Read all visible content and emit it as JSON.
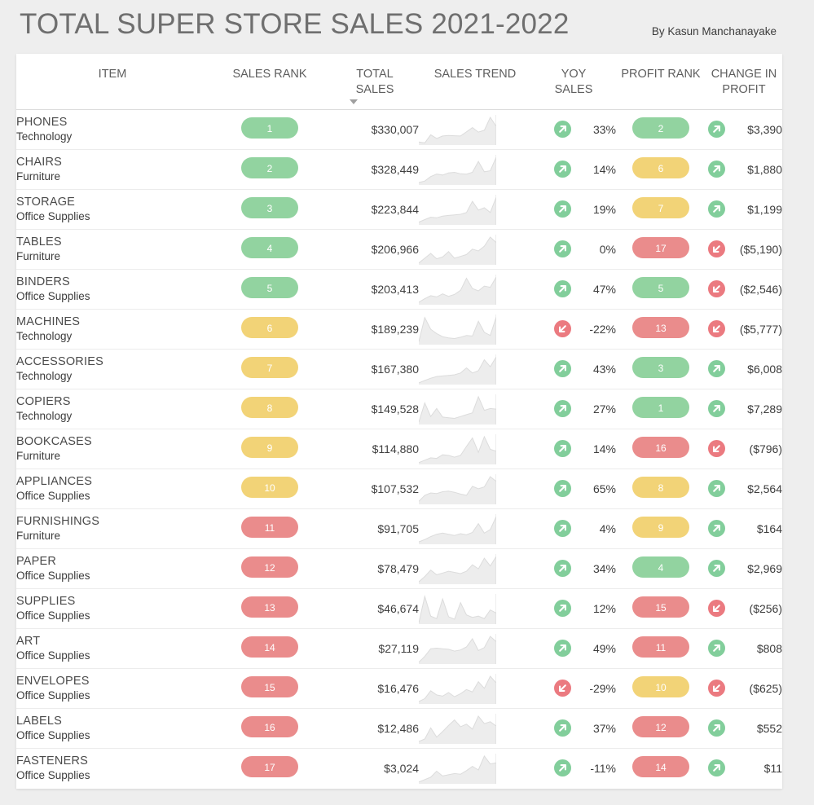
{
  "header": {
    "title": "TOTAL SUPER STORE SALES 2021-2022",
    "byline": "By Kasun Manchanayake"
  },
  "colors": {
    "page_background": "#EEEEEE",
    "card_background": "#FFFFFF",
    "green": "#92D3A0",
    "yellow": "#F2D377",
    "red": "#EA8C8C",
    "sparkline_fill": "#EDEDED",
    "sparkline_stroke": "#DCDCDC",
    "title_text": "#6F6F6F",
    "body_text": "#3C3C3C"
  },
  "table": {
    "columns": [
      {
        "key": "item",
        "label": "ITEM",
        "sorted": false
      },
      {
        "key": "rank",
        "label": "SALES RANK",
        "sorted": false
      },
      {
        "key": "total",
        "label": "TOTAL SALES",
        "sorted": true,
        "sort_direction": "desc"
      },
      {
        "key": "trend",
        "label": "SALES TREND",
        "sorted": false
      },
      {
        "key": "yoy",
        "label": "YOY SALES",
        "sorted": false
      },
      {
        "key": "prank",
        "label": "PROFIT RANK",
        "sorted": false
      },
      {
        "key": "change",
        "label": "CHANGE IN PROFIT",
        "sorted": false
      }
    ],
    "column_labels_wrapped": [
      [
        "ITEM",
        ""
      ],
      [
        "SALES RANK",
        ""
      ],
      [
        "TOTAL",
        "SALES"
      ],
      [
        "SALES TREND",
        ""
      ],
      [
        "YOY",
        "SALES"
      ],
      [
        "PROFIT RANK",
        ""
      ],
      [
        "CHANGE IN",
        "PROFIT"
      ]
    ],
    "rows": [
      {
        "item": "PHONES",
        "category": "Technology",
        "sales_rank": "1",
        "sales_rank_color": "green",
        "total_sales": "$330,007",
        "yoy_sales": "33%",
        "yoy_direction": "up",
        "profit_rank": "2",
        "profit_rank_color": "green",
        "change_in_profit": "$3,390",
        "change_direction": "up",
        "trend": [
          10,
          7,
          34,
          22,
          30,
          32,
          31,
          30,
          44,
          58,
          43,
          49,
          92,
          62
        ]
      },
      {
        "item": "CHAIRS",
        "category": "Furniture",
        "sales_rank": "2",
        "sales_rank_color": "green",
        "total_sales": "$328,449",
        "yoy_sales": "14%",
        "yoy_direction": "up",
        "profit_rank": "6",
        "profit_rank_color": "yellow",
        "change_in_profit": "$1,880",
        "change_direction": "up",
        "trend": [
          8,
          13,
          28,
          36,
          33,
          40,
          42,
          37,
          36,
          42,
          78,
          44,
          47,
          92
        ]
      },
      {
        "item": "STORAGE",
        "category": "Office Supplies",
        "sales_rank": "3",
        "sales_rank_color": "green",
        "total_sales": "$223,844",
        "yoy_sales": "19%",
        "yoy_direction": "up",
        "profit_rank": "7",
        "profit_rank_color": "yellow",
        "change_in_profit": "$1,199",
        "change_direction": "up",
        "trend": [
          9,
          18,
          26,
          24,
          30,
          32,
          34,
          36,
          42,
          80,
          50,
          58,
          42,
          94
        ]
      },
      {
        "item": "TABLES",
        "category": "Furniture",
        "sales_rank": "4",
        "sales_rank_color": "green",
        "total_sales": "$206,966",
        "yoy_sales": "0%",
        "yoy_direction": "up",
        "profit_rank": "17",
        "profit_rank_color": "red",
        "change_in_profit": "($5,190)",
        "change_direction": "down",
        "trend": [
          6,
          22,
          38,
          20,
          26,
          44,
          22,
          28,
          34,
          52,
          46,
          62,
          92,
          74
        ]
      },
      {
        "item": "BINDERS",
        "category": "Office Supplies",
        "sales_rank": "5",
        "sales_rank_color": "green",
        "total_sales": "$203,413",
        "yoy_sales": "47%",
        "yoy_direction": "up",
        "profit_rank": "5",
        "profit_rank_color": "green",
        "change_in_profit": "($2,546)",
        "change_direction": "down",
        "trend": [
          8,
          20,
          30,
          26,
          36,
          28,
          34,
          48,
          88,
          54,
          46,
          62,
          58,
          92
        ]
      },
      {
        "item": "MACHINES",
        "category": "Technology",
        "sales_rank": "6",
        "sales_rank_color": "yellow",
        "total_sales": "$189,239",
        "yoy_sales": "-22%",
        "yoy_direction": "down",
        "profit_rank": "13",
        "profit_rank_color": "red",
        "change_in_profit": "($5,777)",
        "change_direction": "down",
        "trend": [
          10,
          88,
          50,
          36,
          26,
          22,
          20,
          24,
          30,
          28,
          76,
          40,
          30,
          90
        ]
      },
      {
        "item": "ACCESSORIES",
        "category": "Technology",
        "sales_rank": "7",
        "sales_rank_color": "yellow",
        "total_sales": "$167,380",
        "yoy_sales": "43%",
        "yoy_direction": "up",
        "profit_rank": "3",
        "profit_rank_color": "green",
        "change_in_profit": "$6,008",
        "change_direction": "up",
        "trend": [
          6,
          14,
          22,
          28,
          30,
          32,
          34,
          40,
          58,
          40,
          48,
          86,
          62,
          96
        ]
      },
      {
        "item": "COPIERS",
        "category": "Technology",
        "sales_rank": "8",
        "sales_rank_color": "yellow",
        "total_sales": "$149,528",
        "yoy_sales": "27%",
        "yoy_direction": "up",
        "profit_rank": "1",
        "profit_rank_color": "green",
        "change_in_profit": "$7,289",
        "change_direction": "up",
        "trend": [
          8,
          70,
          26,
          52,
          24,
          22,
          20,
          26,
          32,
          38,
          90,
          46,
          52,
          50
        ]
      },
      {
        "item": "BOOKCASES",
        "category": "Furniture",
        "sales_rank": "9",
        "sales_rank_color": "yellow",
        "total_sales": "$114,880",
        "yoy_sales": "14%",
        "yoy_direction": "up",
        "profit_rank": "16",
        "profit_rank_color": "red",
        "change_in_profit": "($796)",
        "change_direction": "down",
        "trend": [
          6,
          14,
          22,
          20,
          32,
          30,
          24,
          30,
          60,
          88,
          40,
          92,
          50,
          44
        ]
      },
      {
        "item": "APPLIANCES",
        "category": "Office Supplies",
        "sales_rank": "10",
        "sales_rank_color": "yellow",
        "total_sales": "$107,532",
        "yoy_sales": "65%",
        "yoy_direction": "up",
        "profit_rank": "8",
        "profit_rank_color": "yellow",
        "change_in_profit": "$2,564",
        "change_direction": "up",
        "trend": [
          10,
          30,
          38,
          36,
          42,
          44,
          40,
          34,
          30,
          60,
          52,
          58,
          92,
          76
        ]
      },
      {
        "item": "FURNISHINGS",
        "category": "Furniture",
        "sales_rank": "11",
        "sales_rank_color": "red",
        "total_sales": "$91,705",
        "yoy_sales": "4%",
        "yoy_direction": "up",
        "profit_rank": "9",
        "profit_rank_color": "yellow",
        "change_in_profit": "$164",
        "change_direction": "up",
        "trend": [
          8,
          16,
          26,
          34,
          38,
          34,
          30,
          36,
          32,
          40,
          70,
          38,
          50,
          94
        ]
      },
      {
        "item": "PAPER",
        "category": "Office Supplies",
        "sales_rank": "12",
        "sales_rank_color": "red",
        "total_sales": "$78,479",
        "yoy_sales": "34%",
        "yoy_direction": "up",
        "profit_rank": "4",
        "profit_rank_color": "green",
        "change_in_profit": "$2,969",
        "change_direction": "up",
        "trend": [
          8,
          26,
          48,
          32,
          38,
          44,
          40,
          36,
          44,
          66,
          52,
          88,
          62,
          94
        ]
      },
      {
        "item": "SUPPLIES",
        "category": "Office Supplies",
        "sales_rank": "13",
        "sales_rank_color": "red",
        "total_sales": "$46,674",
        "yoy_sales": "12%",
        "yoy_direction": "up",
        "profit_rank": "15",
        "profit_rank_color": "red",
        "change_in_profit": "($256)",
        "change_direction": "down",
        "trend": [
          4,
          90,
          26,
          18,
          82,
          24,
          16,
          70,
          30,
          22,
          26,
          18,
          46,
          36
        ]
      },
      {
        "item": "ART",
        "category": "Office Supplies",
        "sales_rank": "14",
        "sales_rank_color": "red",
        "total_sales": "$27,119",
        "yoy_sales": "49%",
        "yoy_direction": "up",
        "profit_rank": "11",
        "profit_rank_color": "red",
        "change_in_profit": "$808",
        "change_direction": "up",
        "trend": [
          6,
          26,
          52,
          54,
          52,
          50,
          44,
          48,
          58,
          86,
          46,
          56,
          94,
          76
        ]
      },
      {
        "item": "ENVELOPES",
        "category": "Office Supplies",
        "sales_rank": "15",
        "sales_rank_color": "red",
        "total_sales": "$16,476",
        "yoy_sales": "-29%",
        "yoy_direction": "down",
        "profit_rank": "10",
        "profit_rank_color": "yellow",
        "change_in_profit": "($625)",
        "change_direction": "down",
        "trend": [
          8,
          18,
          44,
          30,
          26,
          38,
          24,
          34,
          48,
          40,
          74,
          52,
          92,
          70
        ]
      },
      {
        "item": "LABELS",
        "category": "Office Supplies",
        "sales_rank": "16",
        "sales_rank_color": "red",
        "total_sales": "$12,486",
        "yoy_sales": "37%",
        "yoy_direction": "up",
        "profit_rank": "12",
        "profit_rank_color": "red",
        "change_in_profit": "$552",
        "change_direction": "up",
        "trend": [
          8,
          16,
          52,
          22,
          40,
          60,
          78,
          56,
          64,
          48,
          90,
          66,
          72,
          58
        ]
      },
      {
        "item": "FASTENERS",
        "category": "Office Supplies",
        "sales_rank": "17",
        "sales_rank_color": "red",
        "total_sales": "$3,024",
        "yoy_sales": "-11%",
        "yoy_direction": "up",
        "profit_rank": "14",
        "profit_rank_color": "red",
        "change_in_profit": "$11",
        "change_direction": "up",
        "trend": [
          6,
          14,
          22,
          42,
          26,
          30,
          34,
          32,
          44,
          58,
          46,
          92,
          66,
          70
        ]
      }
    ]
  },
  "icons": {
    "arrow_up": "arrow-up-right-icon",
    "arrow_down": "arrow-down-left-icon",
    "sort_desc": "sort-descending-caret-icon"
  }
}
